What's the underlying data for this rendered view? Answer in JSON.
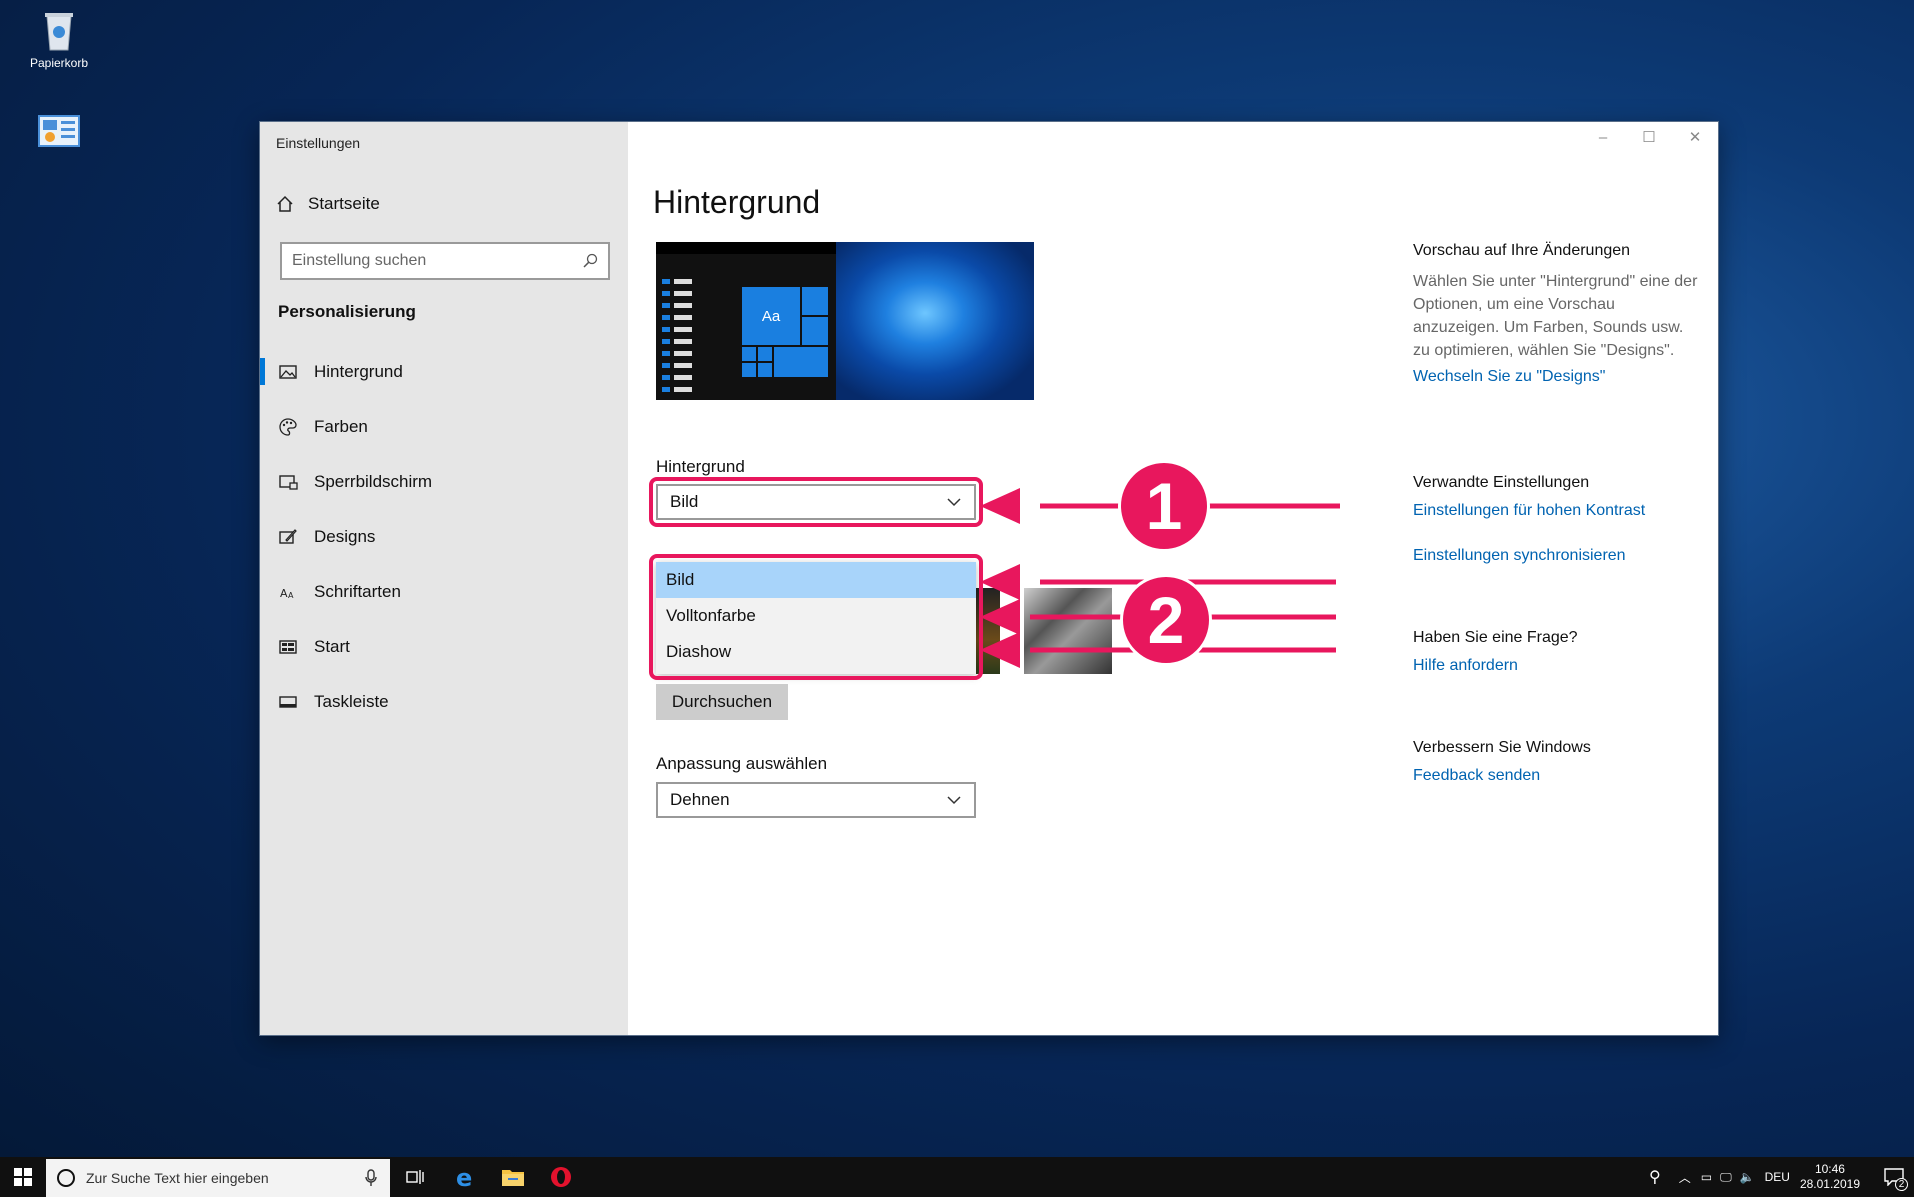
{
  "desktop": {
    "icons": [
      {
        "name": "recycle-bin",
        "label": "Papierkorb"
      },
      {
        "name": "control-panel",
        "label": ""
      }
    ]
  },
  "window": {
    "title": "Einstellungen",
    "controls": {
      "minimize": "–",
      "maximize": "☐",
      "close": "✕"
    }
  },
  "sidebar": {
    "home_label": "Startseite",
    "search_placeholder": "Einstellung suchen",
    "section_title": "Personalisierung",
    "items": [
      {
        "label": "Hintergrund",
        "icon": "image-icon",
        "active": true
      },
      {
        "label": "Farben",
        "icon": "palette-icon",
        "active": false
      },
      {
        "label": "Sperrbildschirm",
        "icon": "lock-screen-icon",
        "active": false
      },
      {
        "label": "Designs",
        "icon": "brush-icon",
        "active": false
      },
      {
        "label": "Schriftarten",
        "icon": "font-icon",
        "active": false
      },
      {
        "label": "Start",
        "icon": "start-icon",
        "active": false
      },
      {
        "label": "Taskleiste",
        "icon": "taskbar-icon",
        "active": false
      }
    ]
  },
  "main": {
    "title": "Hintergrund",
    "preview_tile_text": "Aa",
    "background_label": "Hintergrund",
    "background_value": "Bild",
    "dropdown_options": [
      "Bild",
      "Volltonfarbe",
      "Diashow"
    ],
    "selected_option": "Bild",
    "browse_button": "Durchsuchen",
    "fit_label": "Anpassung auswählen",
    "fit_value": "Dehnen"
  },
  "right": {
    "preview_heading": "Vorschau auf Ihre Änderungen",
    "preview_text": "Wählen Sie unter \"Hintergrund\" eine der Optionen, um eine Vorschau anzuzeigen. Um Farben, Sounds usw. zu optimieren, wählen Sie \"Designs\".",
    "designs_link": "Wechseln Sie zu \"Designs\"",
    "related_heading": "Verwandte Einstellungen",
    "contrast_link": "Einstellungen für hohen Kontrast",
    "sync_link": "Einstellungen synchronisieren",
    "question_heading": "Haben Sie eine Frage?",
    "help_link": "Hilfe anfordern",
    "improve_heading": "Verbessern Sie Windows",
    "feedback_link": "Feedback senden"
  },
  "annotations": {
    "badge1": "1",
    "badge2": "2",
    "color": "#e8175d"
  },
  "taskbar": {
    "search_placeholder": "Zur Suche Text hier eingeben",
    "language": "DEU",
    "time": "10:46",
    "date": "28.01.2019",
    "notification_count": "2"
  }
}
